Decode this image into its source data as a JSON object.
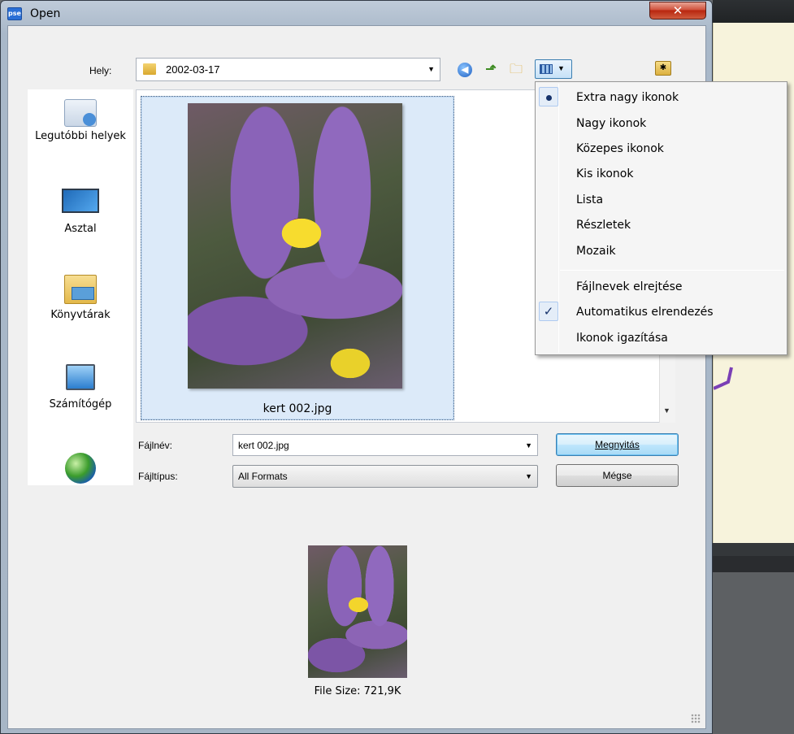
{
  "window": {
    "title": "Open",
    "close_glyph": "✕",
    "app_icon_text": "pse"
  },
  "location": {
    "label": "Hely:",
    "value": "2002-03-17",
    "toolbar_icons": [
      "back-icon",
      "up-folder-icon",
      "new-folder-icon",
      "view-menu-icon",
      "favorites-folder-icon"
    ]
  },
  "places": [
    {
      "label": "Legutóbbi helyek",
      "icon": "recent-places-icon"
    },
    {
      "label": "Asztal",
      "icon": "desktop-icon"
    },
    {
      "label": "Könyvtárak",
      "icon": "libraries-icon"
    },
    {
      "label": "Számítógép",
      "icon": "computer-icon"
    },
    {
      "label": "",
      "icon": "network-icon"
    }
  ],
  "files": [
    {
      "name": "kert 002.jpg",
      "selected": true
    }
  ],
  "filename": {
    "label": "Fájlnév:",
    "value": "kert 002.jpg"
  },
  "filetype": {
    "label": "Fájltípus:",
    "value": "All Formats"
  },
  "buttons": {
    "open": "Megnyitás",
    "cancel": "Mégse"
  },
  "preview": {
    "file_size": "File Size: 721,9K"
  },
  "view_menu": {
    "items": [
      {
        "label": "Extra nagy ikonok",
        "mark": "bullet"
      },
      {
        "label": "Nagy ikonok",
        "mark": ""
      },
      {
        "label": "Közepes ikonok",
        "mark": ""
      },
      {
        "label": "Kis ikonok",
        "mark": ""
      },
      {
        "label": "Lista",
        "mark": ""
      },
      {
        "label": "Részletek",
        "mark": ""
      },
      {
        "label": "Mozaik",
        "mark": ""
      },
      {
        "label": "Fájlnevek elrejtése",
        "mark": ""
      },
      {
        "label": "Automatikus elrendezés",
        "mark": "check"
      },
      {
        "label": "Ikonok igazítása",
        "mark": ""
      }
    ]
  },
  "colors": {
    "accent": "#3c7fb1",
    "selection": "#dceaf9",
    "menu_mark": "#16326b"
  }
}
